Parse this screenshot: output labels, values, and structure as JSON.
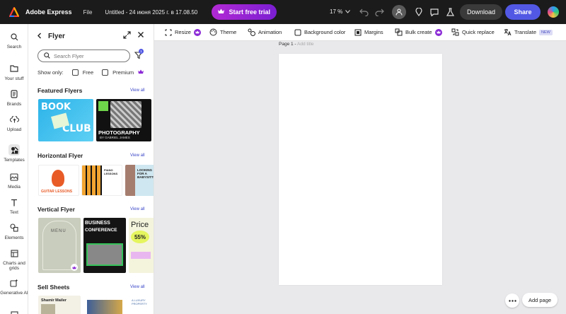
{
  "topbar": {
    "app_name": "Adobe Express",
    "file_menu": "File",
    "doc_title": "Untitled - 24 июня 2025 г. в 17.08.50",
    "trial_label": "Start free trial",
    "zoom": "17 %",
    "download_label": "Download",
    "share_label": "Share"
  },
  "rail": {
    "search": "Search",
    "your_stuff": "Your stuff",
    "brands": "Brands",
    "upload": "Upload",
    "templates": "Templates",
    "media": "Media",
    "text": "Text",
    "elements": "Elements",
    "charts": "Charts and grids",
    "generative": "Generative AI"
  },
  "panel": {
    "title": "Flyer",
    "search_placeholder": "Search Flyer",
    "filter_count": "1",
    "show_only": "Show only:",
    "free": "Free",
    "premium": "Premium",
    "view_all": "View all",
    "sections": {
      "featured": "Featured Flyers",
      "horizontal": "Horizontal Flyer",
      "vertical": "Vertical Flyer",
      "sell": "Sell Sheets"
    },
    "thumbs": {
      "book_top": "BOOK",
      "book_bottom": "CLUB",
      "photo_title": "PHOTOGRAPHY",
      "photo_sub": "BY GABRIEL JAMES",
      "guitar": "GUITAR LESSONS",
      "piano": "PIANO LESSONS",
      "babysitter": "LOOKING FOR A BABYSITTER",
      "menu": "MENU",
      "business_1": "BUSINESS",
      "business_2": "CONFERENCE",
      "price": "Price",
      "price_pct": "55%",
      "shamir": "Shamir Mailer",
      "luxury": "A LUXURY PROPERTY"
    }
  },
  "toolbar": {
    "resize": "Resize",
    "theme": "Theme",
    "animation": "Animation",
    "background": "Background color",
    "margins": "Margins",
    "bulk": "Bulk create",
    "quick_replace": "Quick replace",
    "translate": "Translate",
    "new_badge": "NEW"
  },
  "canvas": {
    "page_label": "Page 1 -",
    "add_title": "Add title",
    "add_page": "Add page"
  },
  "colors": {
    "topbar_bg": "#1b1b1b",
    "share": "#5258e4",
    "trial": "#9a24d4",
    "link": "#3a46c8"
  }
}
